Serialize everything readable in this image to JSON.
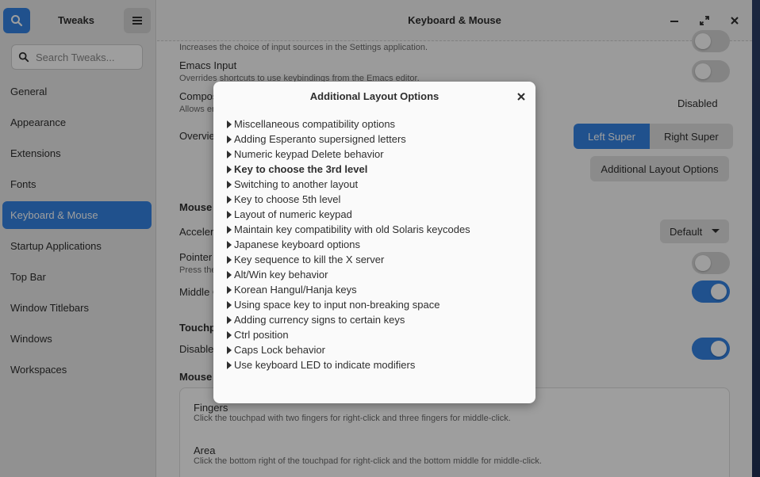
{
  "sidebar": {
    "title": "Tweaks",
    "search_placeholder": "Search Tweaks...",
    "items": [
      {
        "label": "General"
      },
      {
        "label": "Appearance"
      },
      {
        "label": "Extensions"
      },
      {
        "label": "Fonts"
      },
      {
        "label": "Keyboard & Mouse",
        "active": true
      },
      {
        "label": "Startup Applications"
      },
      {
        "label": "Top Bar"
      },
      {
        "label": "Window Titlebars"
      },
      {
        "label": "Windows"
      },
      {
        "label": "Workspaces"
      }
    ]
  },
  "header": {
    "title": "Keyboard & Mouse"
  },
  "content": {
    "input_sources_sub": "Increases the choice of input sources in the Settings application.",
    "emacs_title": "Emacs Input",
    "emacs_sub": "Overrides shortcuts to use keybindings from the Emacs editor.",
    "compose_title": "Compos",
    "compose_sub": "Allows en",
    "compose_status": "Disabled",
    "overview_title": "Overvie",
    "overview_left": "Left Super",
    "overview_right": "Right Super",
    "additional_layout_button": "Additional Layout Options",
    "mouse_section": "Mouse",
    "accel_title": "Acceler",
    "accel_value": "Default",
    "pointer_title": "Pointer",
    "pointer_sub": "Press the",
    "middle_title": "Middle C",
    "touchpad_section": "Touchp",
    "disable_title": "Disable",
    "mouse_click_section": "Mouse C",
    "fingers_title": "Fingers",
    "fingers_sub": "Click the touchpad with two fingers for right-click and three fingers for middle-click.",
    "area_title": "Area",
    "area_sub": "Click the bottom right of the touchpad for right-click and the bottom middle for middle-click."
  },
  "dialog": {
    "title": "Additional Layout Options",
    "options": [
      "Miscellaneous compatibility options",
      "Adding Esperanto supersigned letters",
      "Numeric keypad Delete behavior",
      "Key to choose the 3rd level",
      "Switching to another layout",
      "Key to choose 5th level",
      "Layout of numeric keypad",
      "Maintain key compatibility with old Solaris keycodes",
      "Japanese keyboard options",
      "Key sequence to kill the X server",
      "Alt/Win key behavior",
      "Korean Hangul/Hanja keys",
      "Using space key to input non-breaking space",
      "Adding currency signs to certain keys",
      "Ctrl position",
      "Caps Lock behavior",
      "Use keyboard LED to indicate modifiers"
    ],
    "bold_option_index": 3
  },
  "colors": {
    "accent": "#3584e4"
  }
}
